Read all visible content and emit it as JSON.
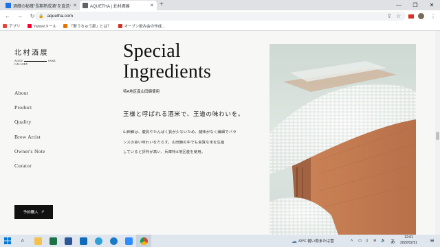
{
  "browser": {
    "tabs": [
      {
        "title": "酒蔵の秘蔵\"長期熟成酒\"を直送サ...",
        "favicon_color": "#1a73e8"
      },
      {
        "title": "AQUETHA | 北村酒展",
        "favicon_color": "#5f6368"
      }
    ],
    "new_tab_label": "+",
    "url": "aquetha.com",
    "bookmarks": [
      {
        "label": "アプリ",
        "icon_color": "#ea4335"
      },
      {
        "label": "Yahoo!メール",
        "icon_color": "#ff0033"
      },
      {
        "label": "「斬うちゅう部」とは？",
        "icon_color": "#e37400"
      },
      {
        "label": "オーブン飲み会の作成...",
        "icon_color": "#d93025"
      }
    ]
  },
  "site": {
    "logo_kanji": "北村酒展",
    "logo_sub_left": "Aged",
    "logo_sub_right": "Sake",
    "logo_sub2": "Gallery",
    "nav": [
      "About",
      "Product",
      "Quality",
      "Brew Artist",
      "Owner's Note",
      "Curator"
    ],
    "reserve_button": "予約購入",
    "reserve_icon": "external-link-icon",
    "title_line1": "Special",
    "title_line2": "Ingredients",
    "subtitle": "特A地区産山田錦使用",
    "heading": "王様と呼ばれる酒米で、王道の味わいを。",
    "body_lines": [
      "山田錦は、腹質やたんぱく質が少ないため、雑味がなく繊細でバラ",
      "ンスの良い味わいをたらす。山田錦の中でも良質な米を生産",
      "していると評判が高い、兵庫特A地区産を使用。"
    ]
  },
  "taskbar": {
    "weather": "43°F 弱い雨または雪",
    "time": "12:01",
    "date": "2022/02/21",
    "ime": "あ"
  },
  "colors": {
    "page_bg": "#f7f7f5",
    "reserve_bg": "#111111",
    "chrome_bg": "#dfe1e5",
    "taskbar_bg": "#dfe6ee"
  }
}
